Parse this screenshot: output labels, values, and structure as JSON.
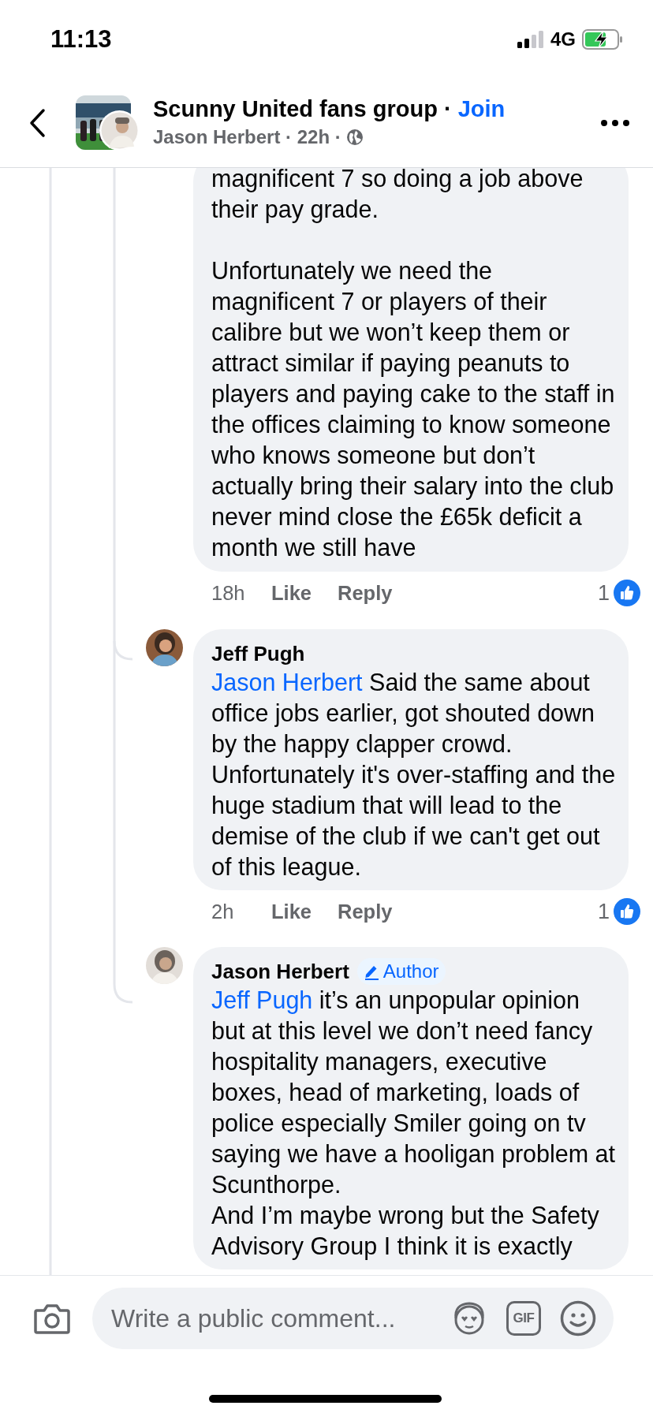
{
  "status_bar": {
    "time": "11:13",
    "network": "4G"
  },
  "header": {
    "title": "Scunny United fans group ·",
    "join": "Join",
    "subtitle": "Jason Herbert · 22h ·"
  },
  "comments": [
    {
      "paragraphs": [
        {
          "lines": [
            "magnificent 7 so doing a job above their pay grade."
          ]
        },
        {
          "lines": [
            "Unfortunately we need the magnificent 7 or players of their calibre but we won’t keep them or attract similar if paying peanuts to players and paying cake to the staff in the offices claiming to know someone who knows someone but don’t actually bring their salary into the club never mind close the £65k deficit a month we still have"
          ]
        }
      ],
      "time": "18h",
      "like": "Like",
      "reply": "Reply",
      "reactions": "1"
    },
    {
      "author": "Jeff Pugh",
      "paragraphs": [
        {
          "mention": "Jason Herbert",
          "lines": [
            "Said the same about office jobs earlier, got shouted down by the happy clapper crowd. Unfortunately it's over-staffing and the huge stadium that will lead to the demise of the club if we can't get out of this league."
          ]
        }
      ],
      "time": "2h",
      "like": "Like",
      "reply": "Reply",
      "reactions": "1"
    },
    {
      "author": "Jason Herbert",
      "badge": "Author",
      "paragraphs": [
        {
          "mention": "Jeff Pugh",
          "lines": [
            "it’s an unpopular opinion but at this level we don’t need fancy hospitality managers, executive boxes, head of marketing, loads of police especially Smiler going on tv saying we have a hooligan problem at Scunthorpe.",
            "And I’m maybe wrong but the Safety Advisory Group I think it is exactly"
          ]
        }
      ]
    }
  ],
  "composer": {
    "placeholder": "Write a public comment...",
    "gif_label": "GIF"
  }
}
